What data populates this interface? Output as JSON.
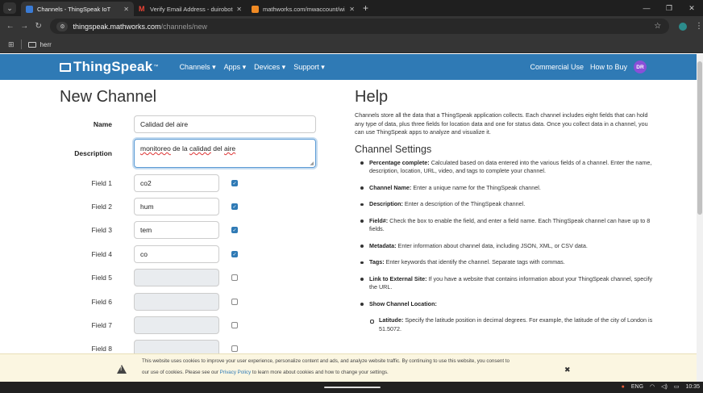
{
  "browser": {
    "tabs": [
      {
        "title": "Channels - ThingSpeak IoT",
        "active": true,
        "favicon_color": "#3a7bd5"
      },
      {
        "title": "Verify Email Address - duirobot",
        "active": false,
        "favicon_color": "#ea4335"
      },
      {
        "title": "mathworks.com/mwaccount/wi",
        "active": false,
        "favicon_color": "#f08a24"
      }
    ],
    "url_host": "thingspeak.mathworks.com",
    "url_path": "/channels/new",
    "bookmark_folder": "herr"
  },
  "nav": {
    "brand": "ThingSpeak",
    "brand_tm": "™",
    "links": [
      "Channels ▾",
      "Apps ▾",
      "Devices ▾",
      "Support ▾"
    ],
    "commercial": "Commercial Use",
    "how_to_buy": "How to Buy",
    "avatar": "DR",
    "brand_color": "#2f7ab5"
  },
  "form": {
    "title": "New Channel",
    "name_label": "Name",
    "name_value": "Calidad del aire",
    "desc_label": "Description",
    "desc_value_parts": [
      "monitoreo",
      " de la ",
      "calidad",
      " del ",
      "aire"
    ],
    "fields": [
      {
        "label": "Field 1",
        "value": "co2",
        "checked": true
      },
      {
        "label": "Field 2",
        "value": "hum",
        "checked": true
      },
      {
        "label": "Field 3",
        "value": "tem",
        "checked": true
      },
      {
        "label": "Field 4",
        "value": "co",
        "checked": true
      },
      {
        "label": "Field 5",
        "value": "",
        "checked": false
      },
      {
        "label": "Field 6",
        "value": "",
        "checked": false
      },
      {
        "label": "Field 7",
        "value": "",
        "checked": false
      },
      {
        "label": "Field 8",
        "value": "",
        "checked": false
      }
    ]
  },
  "help": {
    "title": "Help",
    "intro": "Channels store all the data that a ThingSpeak application collects. Each channel includes eight fields that can hold any type of data, plus three fields for location data and one for status data. Once you collect data in a channel, you can use ThingSpeak apps to analyze and visualize it.",
    "settings_title": "Channel Settings",
    "items": [
      {
        "term": "Percentage complete:",
        "text": " Calculated based on data entered into the various fields of a channel. Enter the name, description, location, URL, video, and tags to complete your channel."
      },
      {
        "term": "Channel Name:",
        "text": " Enter a unique name for the ThingSpeak channel."
      },
      {
        "term": "Description:",
        "text": " Enter a description of the ThingSpeak channel."
      },
      {
        "term": "Field#:",
        "text": " Check the box to enable the field, and enter a field name. Each ThingSpeak channel can have up to 8 fields."
      },
      {
        "term": "Metadata:",
        "text": " Enter information about channel data, including JSON, XML, or CSV data."
      },
      {
        "term": "Tags:",
        "text": " Enter keywords that identify the channel. Separate tags with commas."
      },
      {
        "term": "Link to External Site:",
        "text": " If you have a website that contains information about your ThingSpeak channel, specify the URL."
      },
      {
        "term": "Show Channel Location:",
        "text": ""
      }
    ],
    "sub_item": {
      "term": "Latitude:",
      "text": " Specify the latitude position in decimal degrees. For example, the latitude of the city of London is 51.5072."
    }
  },
  "cookie": {
    "line1": "This website uses cookies to improve your user experience, personalize content and ads, and analyze website traffic. By continuing to use this website, you consent to",
    "line2_pre": "our use of cookies. Please see our ",
    "line2_link": "Privacy Policy",
    "line2_post": " to learn more about cookies and how to change your settings.",
    "close": "✖"
  },
  "taskbar": {
    "lang": "ENG",
    "time": "10:35"
  }
}
